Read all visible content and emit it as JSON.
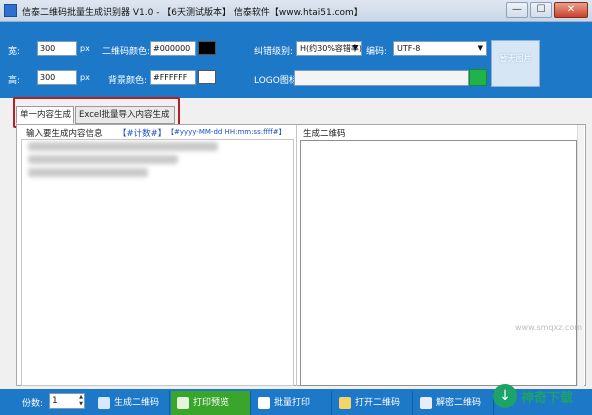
{
  "window": {
    "title": "信泰二维码批量生成识别器 V1.0 - 【6天测试版本】 信泰软件【www.htai51.com】",
    "minimize_glyph": "—",
    "maximize_glyph": "☐",
    "close_glyph": "✕"
  },
  "settings": {
    "width_label": "宽:",
    "width_value": "300",
    "height_label": "高:",
    "height_value": "300",
    "unit": "px",
    "qr_color_label": "二维码颜色:",
    "qr_color_value": "#000000",
    "qr_color_swatch": "#000000",
    "bg_color_label": "背景颜色:",
    "bg_color_value": "#FFFFFF",
    "bg_color_swatch": "#FFFFFF",
    "ecc_label": "纠错级别:",
    "ecc_value": "H(约30%容错率)",
    "encoding_label": "编码:",
    "encoding_value": "UTF-8",
    "logo_label": "LOGO图标:",
    "logo_value": "",
    "preview_text": "暂无图片"
  },
  "tabs": [
    {
      "label": "单一内容生成",
      "active": true
    },
    {
      "label": "Excel批量导入内容生成",
      "active": false
    }
  ],
  "content": {
    "left_header": "输入要生成内容信息",
    "counter": "【#计数#】",
    "datetime": "【#yyyy-MM-dd HH:mm:ss:ffff#】",
    "right_header": "生成二维码"
  },
  "bottom": {
    "copies_label": "份数:",
    "copies_value": "1",
    "actions": [
      {
        "label": "生成二维码",
        "color": "#1d78c8",
        "icon_color": "#d7e9ff"
      },
      {
        "label": "打印预览",
        "color": "#3aa52b",
        "icon_color": "#e3f5dc"
      },
      {
        "label": "批量打印",
        "color": "#1d78c8",
        "icon_color": "#ffffff"
      },
      {
        "label": "打开二维码",
        "color": "#1d78c8",
        "icon_color": "#f3d46a"
      },
      {
        "label": "解密二维码",
        "color": "#1d78c8",
        "icon_color": "#e6edf7"
      }
    ]
  },
  "logo": {
    "text": "神奇下载",
    "watermark": "www.smqxz.com"
  }
}
